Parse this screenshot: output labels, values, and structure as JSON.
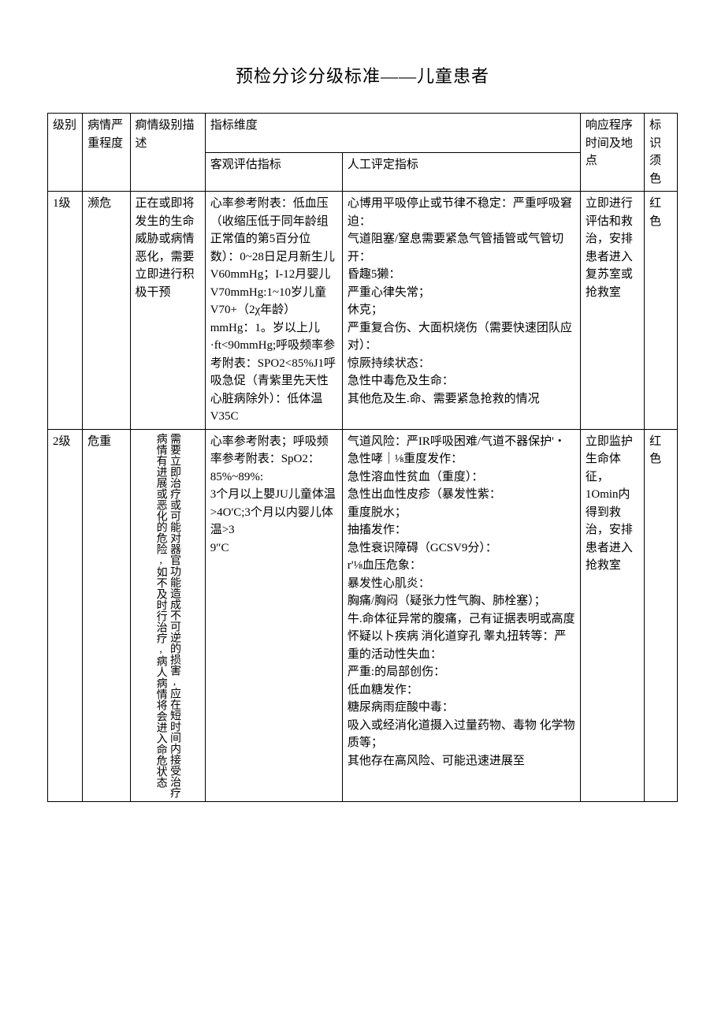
{
  "title": "预检分诊分级标准——儿童患者",
  "header": {
    "level": "级别",
    "severity": "病情严重程度",
    "desc": "痾情级别描述",
    "dim": "指标维度",
    "obj": "客观评估指标",
    "manual": "人工评定指标",
    "response": "响应程序时间及地点",
    "color": "标识须色"
  },
  "rows": [
    {
      "level": "1级",
      "severity": "濒危",
      "desc": "正在或即将发生的生命威胁或病情恶化，需要立即进行积极干预",
      "obj": "心率参考附表：低血压（收缩压低于同年龄组正常值的第5百分位数）：0~28日足月新生儿V60mmHg；I-12月婴儿V70mmHg:1~10岁儿童V70+（2χ年龄）mmHg：1。岁以上儿·ft<90mmHg;呼吸频率参考附表：SPO2<85%J1呼吸急促（青紫里先天性心脏病除外）：低体温V35C",
      "manual": "心博用平吸停止或节律不稳定：严重呼吸窘迫：\n气道阻塞/窒息需要紧急气管插管或气管切开：\n昏趣5獭：\n严重心律失常；\n休克；\n严重复合伤、大面枳烧伤（需要快速团队应对）：\n惊厥持续状态：\n急性中毒危及生命：\n其他危及生.命、需要紧急抢救的情况",
      "response": "立即进行评估和救治，安排患者进入复苏室或抢救室",
      "color": "红色"
    },
    {
      "level": "2级",
      "severity": "危重",
      "desc_cols": [
        "病情有进展或恶化的危险,如不及时行治疗,病人病情将会进入命危状态",
        "需要立即治疗或可能对器官功能造成不可逆的损害,应在短时间内接受治疗"
      ],
      "obj": "心率参考附表；呼吸频率参考附表：SpO2：85%~89%:\n3个月以上嬰JU儿童体温>4O'C;3个月以内婴儿体温>3\n9″C",
      "manual": "气道风险：严IR呼吸困难/气道不器保护'・\n急性哮｜⅛重度发作：\n急性溶血性贫血（重度）：\n急性出血性皮疹（暴发性紫：\n重度脱水；\n抽搐发作：\n急性衰识障碍（GCSV9分）：\nr'⅛血压危象：\n暴发性心肌炎：\n胸痛/胸闷（疑张力性气胸、肺栓塞）；\n牛.命体征异常的腹痛，己有证据表明或高度怀疑以卜疾病 消化道穿孔 睾丸扭转等：严重的活动性失血：\n严重:的局部创伤：\n低血糖发作：\n糖尿病雨症酸中毒：\n吸入或经消化道摄入过量药物、毒物 化学物质等；\n其他存在高风险、可能迅速进展至",
      "response": "立即监护生命体征，1Omin内得到救治，安排患者进入抢救室",
      "color": "红色"
    }
  ]
}
